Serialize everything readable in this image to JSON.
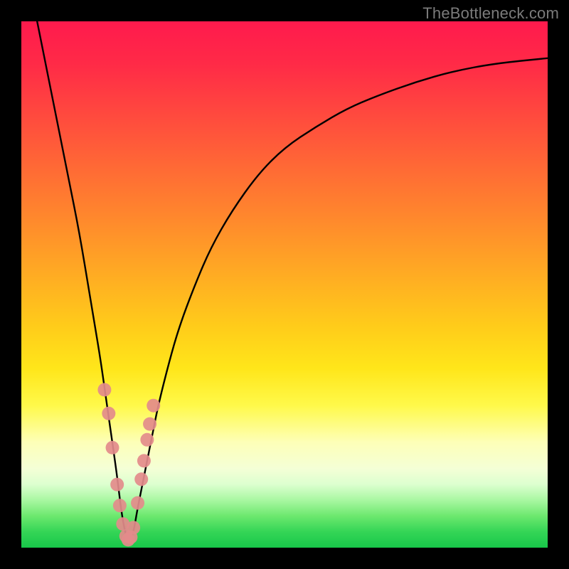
{
  "watermark": "TheBottleneck.com",
  "chart_data": {
    "type": "line",
    "title": "",
    "xlabel": "",
    "ylabel": "",
    "xlim": [
      0,
      100
    ],
    "ylim": [
      0,
      100
    ],
    "grid": false,
    "series": [
      {
        "name": "bottleneck-curve",
        "color": "#000000",
        "x": [
          3,
          5,
          7,
          9,
          11,
          13,
          14,
          15,
          16,
          17,
          18,
          18.5,
          19,
          19.5,
          20,
          20.5,
          21,
          21.5,
          22,
          23,
          24,
          25,
          26,
          28,
          30,
          33,
          36,
          40,
          45,
          50,
          56,
          62,
          68,
          75,
          82,
          90,
          100
        ],
        "y": [
          100,
          90,
          80,
          70,
          60,
          48,
          42,
          36,
          29,
          22,
          15,
          11,
          7,
          4,
          2,
          1,
          2,
          4,
          7,
          12,
          17,
          22,
          27,
          35,
          42,
          50,
          57,
          64,
          71,
          76,
          80,
          83.5,
          86,
          88.5,
          90.5,
          92,
          93
        ]
      }
    ],
    "markers": {
      "name": "data-points",
      "color": "#e38b8b",
      "x": [
        15.8,
        16.6,
        17.3,
        18.2,
        18.7,
        19.3,
        19.9,
        20.3,
        20.8,
        21.3,
        22.1,
        22.8,
        23.3,
        23.9,
        24.4,
        25.1
      ],
      "y": [
        30,
        25.5,
        19,
        12,
        8,
        4.5,
        2.2,
        1.5,
        2,
        3.8,
        8.5,
        13,
        16.5,
        20.5,
        23.5,
        27
      ]
    },
    "background_gradient": {
      "direction": "vertical",
      "stops": [
        {
          "pos": 0.0,
          "color": "#ff1a4d"
        },
        {
          "pos": 0.38,
          "color": "#ff8a2c"
        },
        {
          "pos": 0.66,
          "color": "#ffe61a"
        },
        {
          "pos": 0.85,
          "color": "#f4ffd6"
        },
        {
          "pos": 1.0,
          "color": "#18c74a"
        }
      ]
    }
  }
}
